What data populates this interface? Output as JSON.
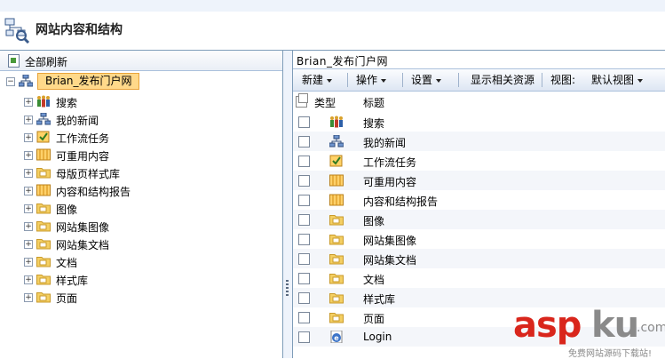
{
  "header": {
    "title": "网站内容和结构"
  },
  "left": {
    "refresh_label": "全部刷新",
    "root_label": "Brian_发布门户网",
    "nodes": [
      {
        "label": "搜索",
        "icon": "people-icon"
      },
      {
        "label": "我的新闻",
        "icon": "network-icon"
      },
      {
        "label": "工作流任务",
        "icon": "task-icon"
      },
      {
        "label": "可重用内容",
        "icon": "list-icon"
      },
      {
        "label": "母版页样式库",
        "icon": "folder-icon"
      },
      {
        "label": "内容和结构报告",
        "icon": "list-icon"
      },
      {
        "label": "图像",
        "icon": "folder-icon"
      },
      {
        "label": "网站集图像",
        "icon": "folder-icon"
      },
      {
        "label": "网站集文档",
        "icon": "folder-icon"
      },
      {
        "label": "文档",
        "icon": "folder-icon"
      },
      {
        "label": "样式库",
        "icon": "folder-icon"
      },
      {
        "label": "页面",
        "icon": "folder-icon"
      }
    ]
  },
  "right": {
    "breadcrumb": "Brian_发布门户网",
    "toolbar": {
      "new": "新建",
      "actions": "操作",
      "settings": "设置",
      "show_related": "显示相关资源",
      "view_label": "视图:",
      "view_value": "默认视图"
    },
    "columns": {
      "type": "类型",
      "title": "标题"
    },
    "rows": [
      {
        "title": "搜索",
        "icon": "people-icon"
      },
      {
        "title": "我的新闻",
        "icon": "network-icon"
      },
      {
        "title": "工作流任务",
        "icon": "task-icon"
      },
      {
        "title": "可重用内容",
        "icon": "list-icon"
      },
      {
        "title": "内容和结构报告",
        "icon": "list-icon"
      },
      {
        "title": "图像",
        "icon": "folder-icon"
      },
      {
        "title": "网站集图像",
        "icon": "folder-icon"
      },
      {
        "title": "网站集文档",
        "icon": "folder-icon"
      },
      {
        "title": "文档",
        "icon": "folder-icon"
      },
      {
        "title": "样式库",
        "icon": "folder-icon"
      },
      {
        "title": "页面",
        "icon": "folder-icon"
      },
      {
        "title": "Login",
        "icon": "ie-page-icon"
      }
    ]
  },
  "watermark": {
    "part1": "asp",
    "part2": "ku",
    "tld": ".com",
    "tagline": "免费网站源码下载站!"
  }
}
